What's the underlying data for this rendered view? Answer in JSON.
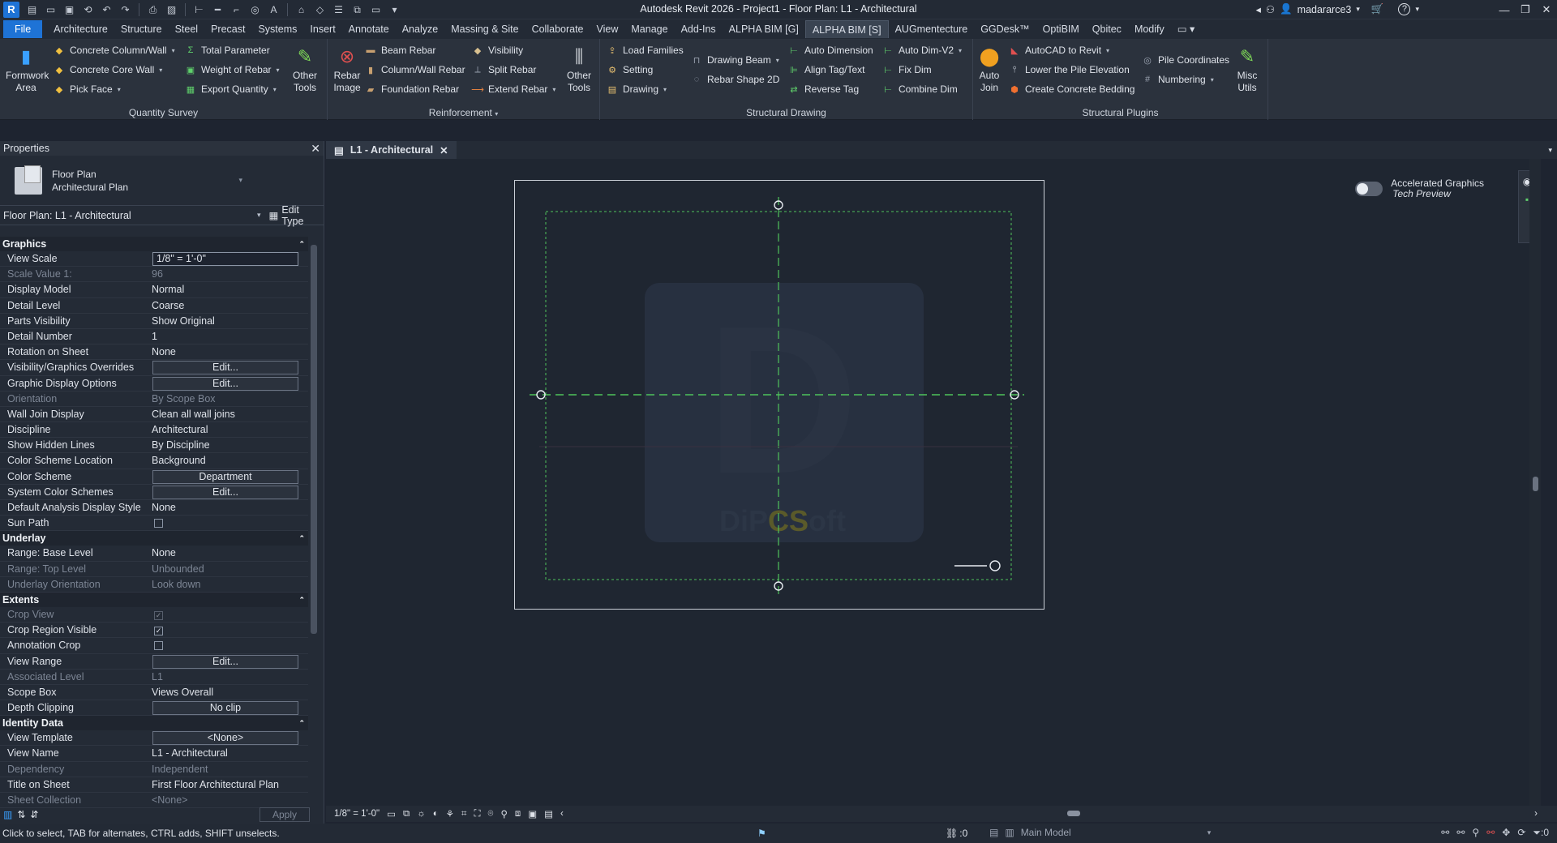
{
  "app": {
    "title": "Autodesk Revit 2026 - Project1 - Floor Plan: L1 - Architectural",
    "logo": "R",
    "user": "madararce3"
  },
  "ribbon_tabs": [
    "File",
    "Architecture",
    "Structure",
    "Steel",
    "Precast",
    "Systems",
    "Insert",
    "Annotate",
    "Analyze",
    "Massing & Site",
    "Collaborate",
    "View",
    "Manage",
    "Add-Ins",
    "ALPHA BIM [G]",
    "ALPHA BIM [S]",
    "AUGmentecture",
    "GGDesk™",
    "OptiBIM",
    "Qbitec",
    "Modify"
  ],
  "active_tab": "ALPHA BIM [S]",
  "ribbon": {
    "quantity_survey": {
      "name": "Quantity Survey",
      "formwork": "Formwork Area",
      "concrete_column_wall": "Concrete Column/Wall",
      "concrete_core_wall": "Concrete Core Wall",
      "pick_face": "Pick Face",
      "total_parameter": "Total Parameter",
      "weight_of_rebar": "Weight of Rebar",
      "export_quantity": "Export Quantity",
      "other_tools": "Other Tools"
    },
    "reinforcement": {
      "name": "Reinforcement",
      "rebar_image": "Rebar Image",
      "beam_rebar": "Beam Rebar",
      "column_wall_rebar": "Column/Wall Rebar",
      "foundation_rebar": "Foundation Rebar",
      "visibility": "Visibility",
      "split_rebar": "Split Rebar",
      "extend_rebar": "Extend Rebar",
      "other_tools": "Other Tools"
    },
    "structural_drawing": {
      "name": "Structural Drawing",
      "load_families": "Load Families",
      "setting": "Setting",
      "drawing": "Drawing",
      "drawing_beam": "Drawing Beam",
      "rebar_shape_2d": "Rebar Shape 2D",
      "auto_dimension": "Auto Dimension",
      "align_tag_text": "Align Tag/Text",
      "reverse_tag": "Reverse Tag",
      "auto_dim_v2": "Auto Dim-V2",
      "fix_dim": "Fix Dim",
      "combine_dim": "Combine Dim"
    },
    "structural_plugins": {
      "name": "Structural Plugins",
      "auto_join": "Auto Join",
      "autocad_to_revit": "AutoCAD to Revit",
      "lower_pile_elevation": "Lower the Pile Elevation",
      "create_concrete_bedding": "Create Concrete Bedding",
      "pile_coordinates": "Pile Coordinates",
      "numbering": "Numbering",
      "misc_utils": "Misc Utils"
    }
  },
  "properties": {
    "header": "Properties",
    "type_line1": "Floor Plan",
    "type_line2": "Architectural Plan",
    "selector": "Floor Plan: L1 - Architectural",
    "edit_type": "Edit Type",
    "apply": "Apply",
    "sections": [
      {
        "title": "Graphics",
        "rows": [
          {
            "label": "View Scale",
            "value": "1/8\" = 1'-0\"",
            "kind": "input"
          },
          {
            "label": "Scale Value    1:",
            "value": "96",
            "kind": "dim"
          },
          {
            "label": "Display Model",
            "value": "Normal"
          },
          {
            "label": "Detail Level",
            "value": "Coarse"
          },
          {
            "label": "Parts Visibility",
            "value": "Show Original"
          },
          {
            "label": "Detail Number",
            "value": "1"
          },
          {
            "label": "Rotation on Sheet",
            "value": "None"
          },
          {
            "label": "Visibility/Graphics Overrides",
            "value": "Edit...",
            "kind": "button"
          },
          {
            "label": "Graphic Display Options",
            "value": "Edit...",
            "kind": "button"
          },
          {
            "label": "Orientation",
            "value": "By Scope Box",
            "kind": "dim"
          },
          {
            "label": "Wall Join Display",
            "value": "Clean all wall joins"
          },
          {
            "label": "Discipline",
            "value": "Architectural"
          },
          {
            "label": "Show Hidden Lines",
            "value": "By Discipline"
          },
          {
            "label": "Color Scheme Location",
            "value": "Background"
          },
          {
            "label": "Color Scheme",
            "value": "Department",
            "kind": "button"
          },
          {
            "label": "System Color Schemes",
            "value": "Edit...",
            "kind": "button"
          },
          {
            "label": "Default Analysis Display Style",
            "value": "None"
          },
          {
            "label": "Sun Path",
            "value": "",
            "kind": "checkbox",
            "checked": false
          }
        ]
      },
      {
        "title": "Underlay",
        "rows": [
          {
            "label": "Range: Base Level",
            "value": "None"
          },
          {
            "label": "Range: Top Level",
            "value": "Unbounded",
            "kind": "dim"
          },
          {
            "label": "Underlay Orientation",
            "value": "Look down",
            "kind": "dim"
          }
        ]
      },
      {
        "title": "Extents",
        "rows": [
          {
            "label": "Crop View",
            "value": "",
            "kind": "checkbox-dim",
            "checked": true
          },
          {
            "label": "Crop Region Visible",
            "value": "",
            "kind": "checkbox",
            "checked": true
          },
          {
            "label": "Annotation Crop",
            "value": "",
            "kind": "checkbox",
            "checked": false
          },
          {
            "label": "View Range",
            "value": "Edit...",
            "kind": "button"
          },
          {
            "label": "Associated Level",
            "value": "L1",
            "kind": "dim"
          },
          {
            "label": "Scope Box",
            "value": "Views Overall"
          },
          {
            "label": "Depth Clipping",
            "value": "No clip",
            "kind": "button"
          }
        ]
      },
      {
        "title": "Identity Data",
        "rows": [
          {
            "label": "View Template",
            "value": "<None>",
            "kind": "button"
          },
          {
            "label": "View Name",
            "value": "L1 - Architectural"
          },
          {
            "label": "Dependency",
            "value": "Independent",
            "kind": "dim"
          },
          {
            "label": "Title on Sheet",
            "value": "First Floor Architectural Plan"
          },
          {
            "label": "Sheet Collection",
            "value": "<None>",
            "kind": "dim"
          }
        ]
      }
    ]
  },
  "view": {
    "tab_label": "L1 - Architectural",
    "watermark_letter": "D",
    "watermark_text_a": "DiP",
    "watermark_text_b": "CS",
    "watermark_text_c": "oft",
    "accel_line1": "Accelerated Graphics",
    "accel_line2": "Tech Preview",
    "scale_label": "1/8\" = 1'-0\""
  },
  "status": {
    "message": "Click to select, TAB for alternates, CTRL adds, SHIFT unselects.",
    "worksets": ":0",
    "main_model": "Main Model",
    "filter_count": ":0"
  },
  "colors": {
    "accent": "#1e73d6",
    "grid_green": "#4fc35a",
    "canvas_bg": "#1f2631"
  }
}
